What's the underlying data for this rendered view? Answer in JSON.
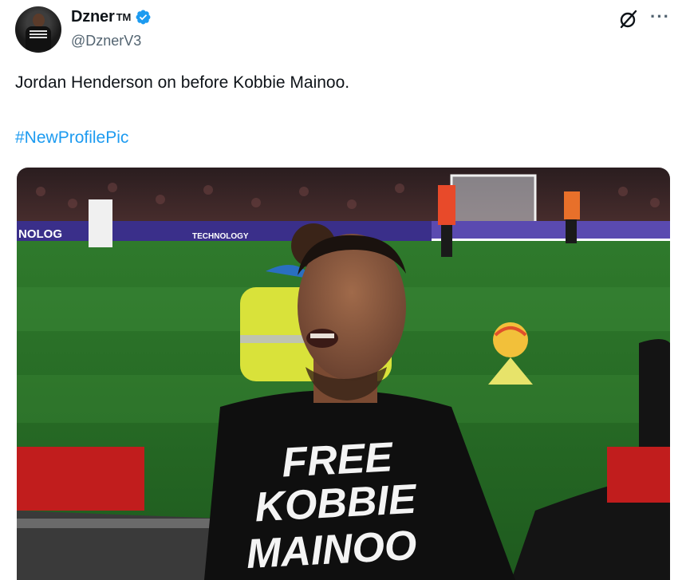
{
  "author": {
    "display_name": "Dzner",
    "tm": "TM",
    "handle": "@DznerV3",
    "verified": true,
    "avatar_icon": "avatar-photo"
  },
  "header_icons": {
    "grok": "grok-icon",
    "more": "more-options-icon",
    "more_glyph": "···"
  },
  "tweet": {
    "text": "Jordan Henderson on before Kobbie Mainoo.",
    "hashtag": "#NewProfilePic"
  },
  "media": {
    "shirt_line1": "FREE",
    "shirt_line2": "KOBBIE",
    "shirt_line3": "MAINOO",
    "board_text_left": "NOLOG",
    "board_text_mid": "TECHNOLOGY"
  },
  "colors": {
    "hashtag": "#1d9bf0",
    "verified": "#1d9bf0",
    "handle": "#536471"
  }
}
